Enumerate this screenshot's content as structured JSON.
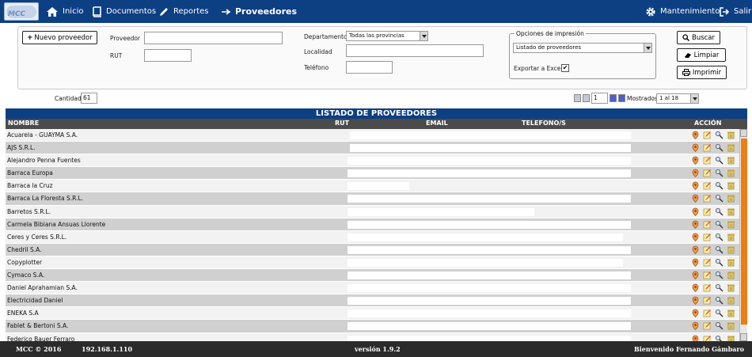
{
  "nav": {
    "logo_text": "MCC",
    "items": [
      {
        "label": "Inicio",
        "icon": "home-icon"
      },
      {
        "label": "Documentos",
        "icon": "book-icon"
      },
      {
        "label": "Reportes",
        "icon": "pencil-icon"
      }
    ],
    "current": "Proveedores",
    "mantenimiento": "Mantenimiento",
    "salir": "Salir"
  },
  "filters": {
    "new_button": "Nuevo proveedor",
    "proveedor_label": "Proveedor",
    "rut_label": "RUT",
    "departamento_label": "Departamento",
    "departamento_value": "Todas las provincias",
    "localidad_label": "Localidad",
    "telefono_label": "Teléfono",
    "print_options_legend": "Opciones de impresión",
    "print_option_value": "Listado de proveedores",
    "export_excel_label": "Exportar a Excel?",
    "export_excel_checked": "✔",
    "buscar": "Buscar",
    "limpiar": "Limpiar",
    "imprimir": "Imprimir"
  },
  "pager": {
    "cantidad_label": "Cantidad",
    "cantidad_value": "61",
    "page_value": "1",
    "mostrados_label": "Mostrados",
    "mostrados_value": "1 al 18"
  },
  "table": {
    "title": "LISTADO DE PROVEEDORES",
    "columns": {
      "nombre": "NOMBRE",
      "rut": "RUT",
      "email": "EMAIL",
      "telefono": "TELEFONO/S",
      "accion": "ACCIÓN"
    },
    "rows": [
      "Acuarela - GUAYMA S.A.",
      "AJS S.R.L.",
      "Alejandro Penna Fuentes",
      "Barraca Europa",
      "Barraca la Cruz",
      "Barraca La Floresta S.R.L.",
      "Barretos S.R.L.",
      "Carmela Bibiana Ansuas Llorente",
      "Ceres y Ceres S.R.L.",
      "Chedril S.A.",
      "Copyplotter",
      "Cymaco S.A.",
      "Daniel Aprahamian S.A.",
      "Electricidad Daniel",
      "ENEKA S.A",
      "Fablet & Bertoni S.A.",
      "Federico Bauer Ferraro"
    ]
  },
  "footer": {
    "copyright": "MCC © 2016",
    "ip": "192.168.1.110",
    "version": "versión 1.9.2",
    "welcome": "Bienvenido Fernando Gámbaro"
  },
  "colors": {
    "nav_bg": "#0d3f83",
    "header_bg": "#4b4b4b",
    "scroll_thumb": "#ef7c13",
    "footer_bg": "#2b2b2b"
  }
}
